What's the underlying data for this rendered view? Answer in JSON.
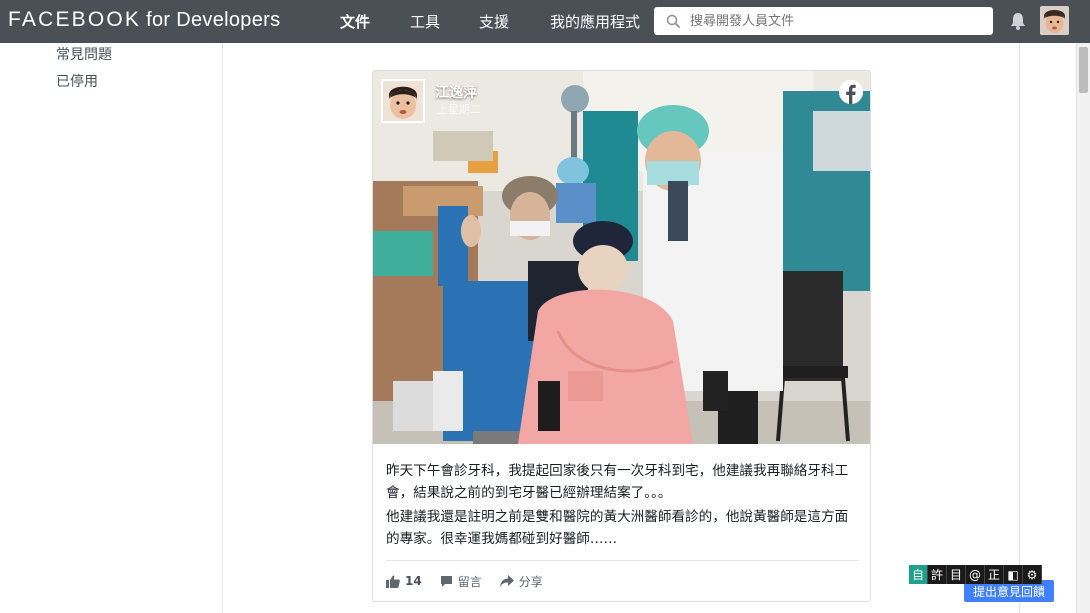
{
  "header": {
    "brand_main": "FACEBOOK",
    "brand_sub": "for Developers",
    "nav": [
      "文件",
      "工具",
      "支援",
      "我的應用程式"
    ],
    "search_placeholder": "搜尋開發人員文件"
  },
  "sidebar": {
    "items": [
      "常見問題",
      "已停用"
    ]
  },
  "post": {
    "page_name": "江逸萍",
    "page_sub": "上星期二",
    "paragraphs": [
      "昨天下午會診牙科，我提起回家後只有一次牙科到宅，他建議我再聯絡牙科工會，結果說之前的到宅牙醫已經辦理結案了。。。",
      "他建議我還是註明之前是雙和醫院的黃大洲醫師看診的，他說黃醫師是這方面的專家。很幸運我媽都碰到好醫師……"
    ],
    "like_count": "14",
    "comment_label": "留言",
    "share_label": "分享"
  },
  "ime_toolbar": [
    "自",
    "許",
    "目",
    "@",
    "正",
    "◧",
    "⚙"
  ],
  "feedback_label": "提出意見回饋",
  "colors": {
    "topbar": "#4b4f56",
    "feedback": "#4080ff",
    "text": "#1c1e21"
  }
}
